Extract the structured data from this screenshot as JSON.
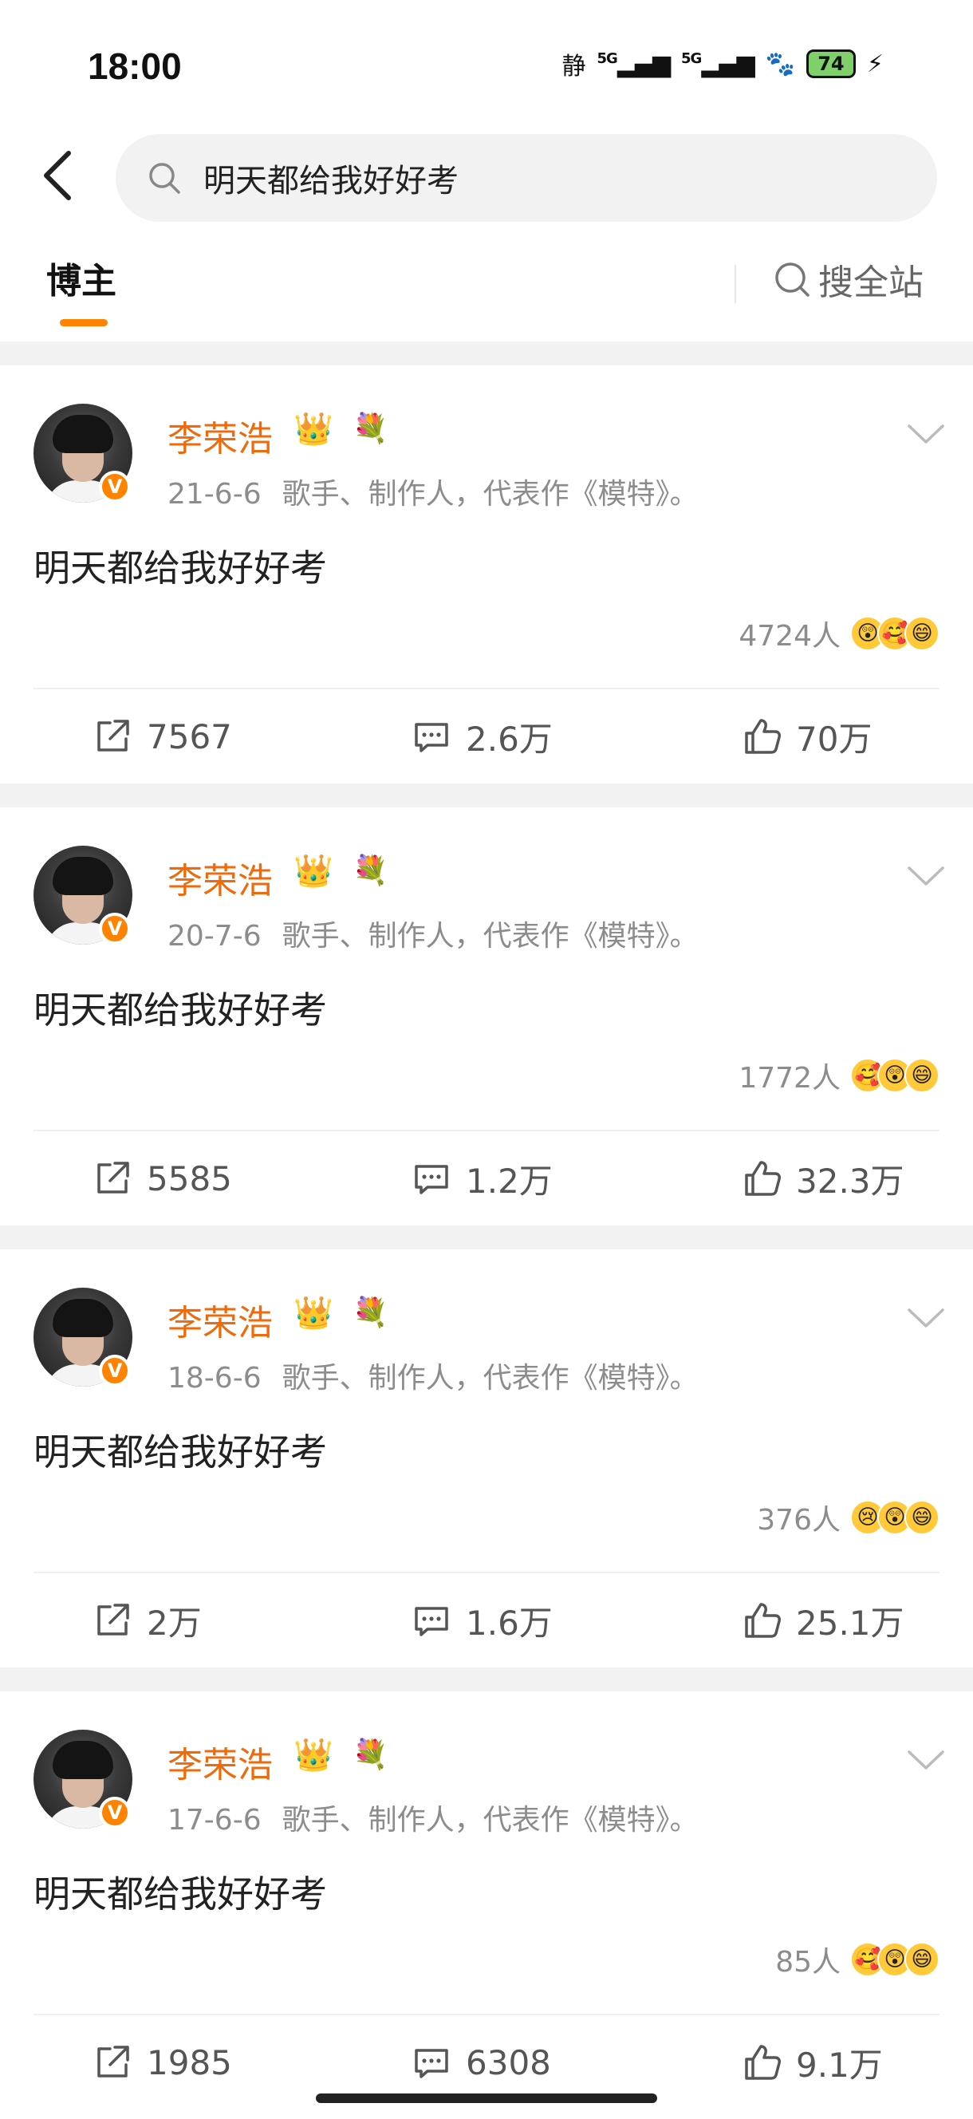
{
  "status_bar": {
    "time": "18:00",
    "quiet_label": "静",
    "net1": "5G",
    "net2": "5G",
    "battery": "74",
    "icons": [
      "quiet-icon",
      "signal-icon",
      "signal-icon",
      "fox-icon",
      "battery-icon",
      "charging-icon"
    ]
  },
  "search": {
    "query": "明天都给我好好考"
  },
  "tabs": {
    "blogger": "博主",
    "search_site": "搜全站"
  },
  "colors": {
    "accent": "#ff8200",
    "username": "#ee6a0a",
    "gray_text": "#8c8c8c"
  },
  "posts": [
    {
      "username": "李荣浩",
      "date": "21-6-6",
      "bio": "歌手、制作人，代表作《模特》。",
      "text": "明天都给我好好考",
      "reactions_count": "4724人",
      "emojis": [
        "😲",
        "🥰",
        "😄"
      ],
      "reposts": "7567",
      "comments": "2.6万",
      "likes": "70万"
    },
    {
      "username": "李荣浩",
      "date": "20-7-6",
      "bio": "歌手、制作人，代表作《模特》。",
      "text": "明天都给我好好考",
      "reactions_count": "1772人",
      "emojis": [
        "🥰",
        "😲",
        "😄"
      ],
      "reposts": "5585",
      "comments": "1.2万",
      "likes": "32.3万"
    },
    {
      "username": "李荣浩",
      "date": "18-6-6",
      "bio": "歌手、制作人，代表作《模特》。",
      "text": "明天都给我好好考",
      "reactions_count": "376人",
      "emojis": [
        "😢",
        "😲",
        "😄"
      ],
      "reposts": "2万",
      "comments": "1.6万",
      "likes": "25.1万"
    },
    {
      "username": "李荣浩",
      "date": "17-6-6",
      "bio": "歌手、制作人，代表作《模特》。",
      "text": "明天都给我好好考",
      "reactions_count": "85人",
      "emojis": [
        "🥰",
        "😲",
        "😄"
      ],
      "reposts": "1985",
      "comments": "6308",
      "likes": "9.1万"
    }
  ]
}
